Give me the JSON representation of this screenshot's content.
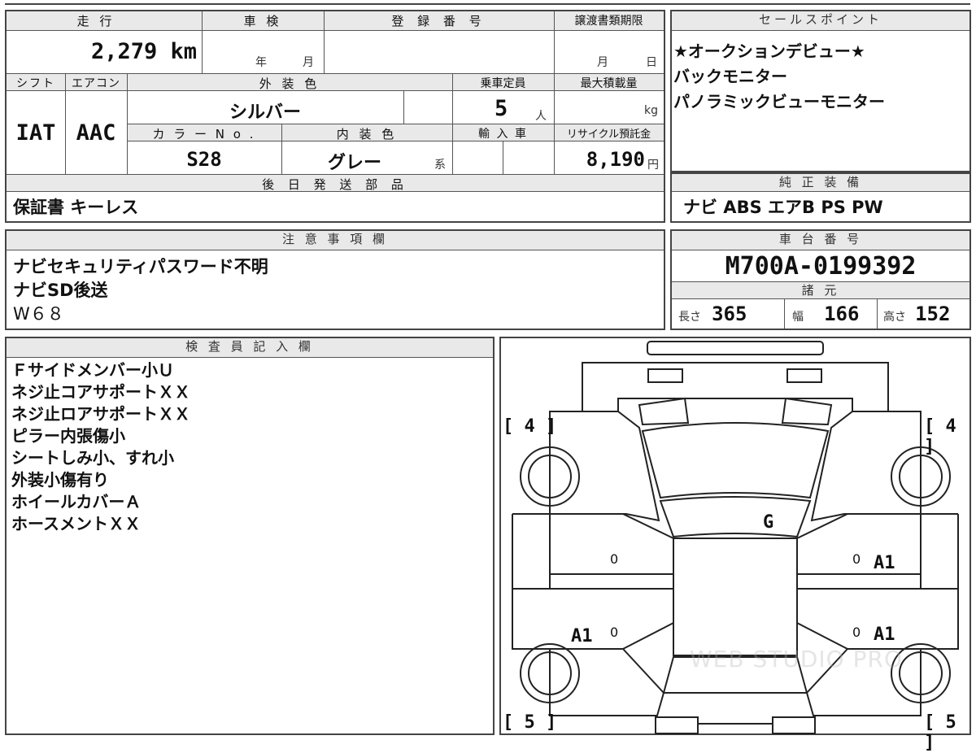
{
  "header": {
    "mileage": "走 行",
    "inspection": "車 検",
    "registration": "登 録 番 号",
    "transfer_deadline": "譲渡書類期限",
    "sales_points": "セールスポイント",
    "shift": "シフト",
    "aircon": "エアコン",
    "exterior_color": "外 装 色",
    "capacity": "乗車定員",
    "max_load": "最大積載量",
    "color_no": "カ ラ ー N o .",
    "interior_color": "内 装 色",
    "import": "輸 入 車",
    "recycle": "リサイクル預託金",
    "later_parts": "後 日 発 送 部 品",
    "genuine_equipment": "純 正 装 備",
    "notes": "注 意 事 項 欄",
    "chassis_no": "車 台 番 号",
    "specs": "諸 元",
    "inspector": "検 査 員 記 入 欄"
  },
  "values": {
    "mileage": "2,279",
    "mileage_unit": "km",
    "inspection_year": "年",
    "inspection_month": "月",
    "deadline_month": "月",
    "deadline_day": "日",
    "shift": "IAT",
    "aircon": "AAC",
    "exterior_color": "シルバー",
    "capacity": "5",
    "capacity_unit": "人",
    "max_load_unit": "kg",
    "color_no": "S28",
    "interior_color": "グレー",
    "interior_suffix": "系",
    "recycle": "8,190",
    "recycle_unit": "円",
    "later_parts": "保証書 キーレス",
    "genuine_equipment": "ナビ ABS エアB PS PW",
    "chassis_no": "M700A-0199392",
    "length_label": "長さ",
    "length": "365",
    "width_label": "幅",
    "width": "166",
    "height_label": "高さ",
    "height": "152"
  },
  "sales_points": [
    "★オークションデビュー★",
    "バックモニター",
    "パノラミックビューモニター"
  ],
  "notes": [
    "ナビセキュリティパスワード不明",
    "ナビSD後送",
    "W６８"
  ],
  "inspector_notes": [
    "Ｆサイドメンバー小Ｕ",
    "ネジ止コアサポートＸＸ",
    "ネジ止ロアサポートＸＸ",
    "ピラー内張傷小",
    "シートしみ小、すれ小",
    "外装小傷有り",
    "ホイールカバーＡ",
    "ホースメントＸＸ"
  ],
  "diagram": {
    "tire_front_left": "[ 4 ]",
    "tire_front_right": "[ 4 ]",
    "tire_rear_left": "[ 5 ]",
    "tire_rear_right": "[ 5 ]",
    "roof_mark": "G",
    "right_front_door_mark": "A1",
    "right_rear_door_mark": "A1",
    "left_rear_door_mark": "A1",
    "zero_mark": "0",
    "watermark": "WEB STUDIO PRO"
  }
}
